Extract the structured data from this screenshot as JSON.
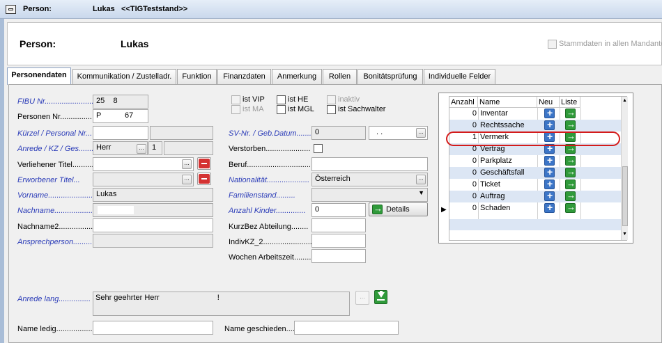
{
  "window": {
    "title_prefix": "Person:",
    "title_name": "Lukas",
    "title_suffix": "<<TIGTeststand>>"
  },
  "header": {
    "label": "Person:",
    "name": "Lukas",
    "checkbox_label": "Stammdaten in allen Mandanten"
  },
  "tabs": [
    {
      "label": "Personendaten"
    },
    {
      "label": "Kommunikation / Zustelladr."
    },
    {
      "label": "Funktion"
    },
    {
      "label": "Finanzdaten"
    },
    {
      "label": "Anmerkung"
    },
    {
      "label": "Rollen"
    },
    {
      "label": "Bonitätsprüfung"
    },
    {
      "label": "Individuelle Felder"
    }
  ],
  "left": {
    "fibu_label": "FIBU Nr.........................",
    "fibu_a": "25",
    "fibu_b": "8",
    "personen_label": "Personen Nr.................",
    "personen_a": "P",
    "personen_b": "67",
    "kuerzel_label": "Kürzel / Personal Nr...",
    "anrede_kz_label": "Anrede / KZ / Ges.......",
    "anrede_value": "Herr",
    "ges_value": "1",
    "titel_label": "Verliehener Titel..........",
    "erw_titel_label": "Erworbener Titel...",
    "vorname_label": "Vorname.......................",
    "vorname_value": "Lukas",
    "nachname_label": "Nachname.......................",
    "nachname2_label": "Nachname2.........................",
    "ansprech_label": "Ansprechperson............",
    "anrede_lang_label": "Anrede lang...............",
    "anrede_lang_value": "Sehr geehrter Herr",
    "anrede_lang_end": "!",
    "name_ledig_label": "Name ledig...............................",
    "name_geschieden_label": "Name geschieden...."
  },
  "middle": {
    "vip_label": "ist VIP",
    "he_label": "ist HE",
    "inaktiv_label": "inaktiv",
    "ma_label": "ist MA",
    "mgl_label": "ist MGL",
    "sachwalter_label": "ist Sachwalter",
    "sv_label": "SV-Nr. / Geb.Datum.......",
    "sv_value": "0",
    "geb_value": ". .",
    "verstorben_label": "Verstorben.....................",
    "beruf_label": "Beruf.................................",
    "nation_label": "Nationalität....................",
    "nation_value": "Österreich",
    "familien_label": "Familienstand.........",
    "kinder_label": "Anzahl Kinder..............",
    "kinder_value": "0",
    "details_label": "Details",
    "kurzbez_label": "KurzBez Abteilung........",
    "indivkz_label": "IndivKZ_2...........................",
    "wochen_label": "Wochen Arbeitszeit........."
  },
  "grid": {
    "columns": [
      "Anzahl",
      "Name",
      "Neu",
      "Liste"
    ],
    "rows": [
      {
        "count": "0",
        "name": "Inventar"
      },
      {
        "count": "0",
        "name": "Rechtssache"
      },
      {
        "count": "1",
        "name": "Vermerk"
      },
      {
        "count": "0",
        "name": "Vertrag"
      },
      {
        "count": "0",
        "name": "Parkplatz"
      },
      {
        "count": "0",
        "name": "Geschäftsfall"
      },
      {
        "count": "0",
        "name": "Ticket"
      },
      {
        "count": "0",
        "name": "Auftrag"
      },
      {
        "count": "0",
        "name": "Schaden"
      }
    ],
    "current_row_marker": "▶"
  },
  "colors": {
    "italic_label": "#2b3cb8",
    "highlight": "#d41b1b",
    "plus": "#3b75c7",
    "arrow": "#2f9a3a",
    "minus": "#d43232"
  },
  "icons": [
    "window-menu-icon",
    "ellipsis-icon",
    "minus-icon",
    "checkbox-icon",
    "dropdown-arrow-icon",
    "arrow-right-icon",
    "plus-icon",
    "download-icon",
    "row-pointer-icon"
  ]
}
